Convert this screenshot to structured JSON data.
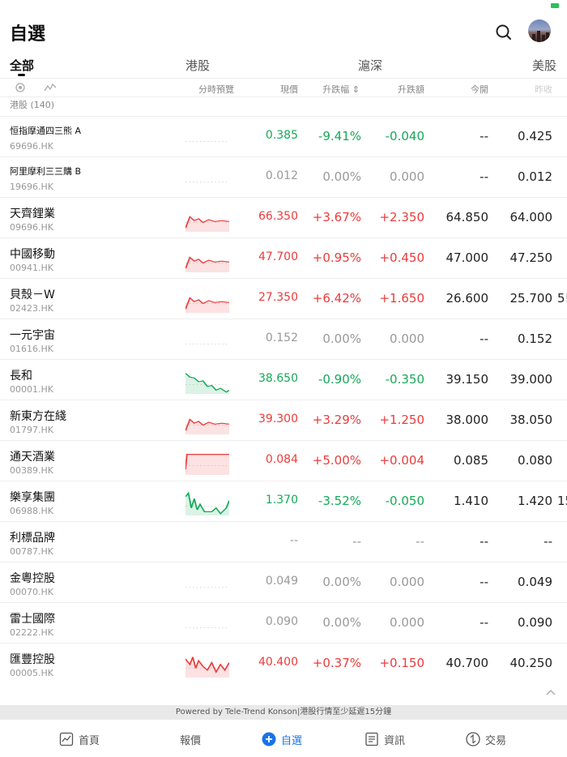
{
  "header": {
    "title": "自選"
  },
  "tabs": [
    {
      "label": "全部",
      "active": true
    },
    {
      "label": "港股"
    },
    {
      "label": "滬深"
    },
    {
      "label": "美股"
    }
  ],
  "columns": {
    "intraday": "分時預覽",
    "price": "現價",
    "pct": "升跌幅 ⇕",
    "change": "升跌額",
    "open": "今開",
    "prev": "昨收"
  },
  "group_label": "港股 (140)",
  "stocks": [
    {
      "name": "恒指摩通四三熊 A",
      "code": "69696.HK",
      "price": "0.385",
      "pct": "-9.41%",
      "change": "-0.040",
      "open": "--",
      "prev": "0.425",
      "trend": "down",
      "spark": "none"
    },
    {
      "name": "阿里摩利三三購 B",
      "code": "19696.HK",
      "price": "0.012",
      "pct": "0.00%",
      "change": "0.000",
      "open": "--",
      "prev": "0.012",
      "trend": "flat",
      "spark": "none"
    },
    {
      "name": "天齊鋰業",
      "code": "09696.HK",
      "price": "66.350",
      "pct": "+3.67%",
      "change": "+2.350",
      "open": "64.850",
      "prev": "64.000",
      "trend": "up",
      "spark": "up"
    },
    {
      "name": "中國移動",
      "code": "00941.HK",
      "price": "47.700",
      "pct": "+0.95%",
      "change": "+0.450",
      "open": "47.000",
      "prev": "47.250",
      "trend": "up",
      "spark": "up"
    },
    {
      "name": "貝殼－W",
      "code": "02423.HK",
      "price": "27.350",
      "pct": "+6.42%",
      "change": "+1.650",
      "open": "26.600",
      "prev": "25.700",
      "extra": "5!",
      "trend": "up",
      "spark": "up"
    },
    {
      "name": "一元宇宙",
      "code": "01616.HK",
      "price": "0.152",
      "pct": "0.00%",
      "change": "0.000",
      "open": "--",
      "prev": "0.152",
      "trend": "flat",
      "spark": "none"
    },
    {
      "name": "長和",
      "code": "00001.HK",
      "price": "38.650",
      "pct": "-0.90%",
      "change": "-0.350",
      "open": "39.150",
      "prev": "39.000",
      "trend": "down",
      "spark": "down"
    },
    {
      "name": "新東方在綫",
      "code": "01797.HK",
      "price": "39.300",
      "pct": "+3.29%",
      "change": "+1.250",
      "open": "38.000",
      "prev": "38.050",
      "trend": "up",
      "spark": "up"
    },
    {
      "name": "通天酒業",
      "code": "00389.HK",
      "price": "0.084",
      "pct": "+5.00%",
      "change": "+0.004",
      "open": "0.085",
      "prev": "0.080",
      "trend": "up",
      "spark": "flatup"
    },
    {
      "name": "樂享集團",
      "code": "06988.HK",
      "price": "1.370",
      "pct": "-3.52%",
      "change": "-0.050",
      "open": "1.410",
      "prev": "1.420",
      "extra": "15",
      "trend": "down",
      "spark": "down2"
    },
    {
      "name": "利標品牌",
      "code": "00787.HK",
      "price": "--",
      "pct": "--",
      "change": "--",
      "open": "--",
      "prev": "--",
      "trend": "flat",
      "spark": "blank"
    },
    {
      "name": "金粵控股",
      "code": "00070.HK",
      "price": "0.049",
      "pct": "0.00%",
      "change": "0.000",
      "open": "--",
      "prev": "0.049",
      "trend": "flat",
      "spark": "none"
    },
    {
      "name": "雷士國際",
      "code": "02222.HK",
      "price": "0.090",
      "pct": "0.00%",
      "change": "0.000",
      "open": "--",
      "prev": "0.090",
      "trend": "flat",
      "spark": "none"
    },
    {
      "name": "匯豐控股",
      "code": "00005.HK",
      "price": "40.400",
      "pct": "+0.37%",
      "change": "+0.150",
      "open": "40.700",
      "prev": "40.250",
      "trend": "up",
      "spark": "upvol"
    }
  ],
  "footer": {
    "powered": "Powered by Tele-Trend Konson|港股行情至少延遲15分鐘"
  },
  "nav": [
    {
      "label": "首頁",
      "icon": "chart-icon"
    },
    {
      "label": "報價",
      "icon": "none"
    },
    {
      "label": "自選",
      "icon": "plus-circle-icon",
      "active": true
    },
    {
      "label": "資訊",
      "icon": "document-icon"
    },
    {
      "label": "交易",
      "icon": "exchange-icon"
    }
  ],
  "colors": {
    "up": "#ec3b3b",
    "down": "#17a959",
    "flat": "#999999",
    "accent": "#1a73e8"
  }
}
